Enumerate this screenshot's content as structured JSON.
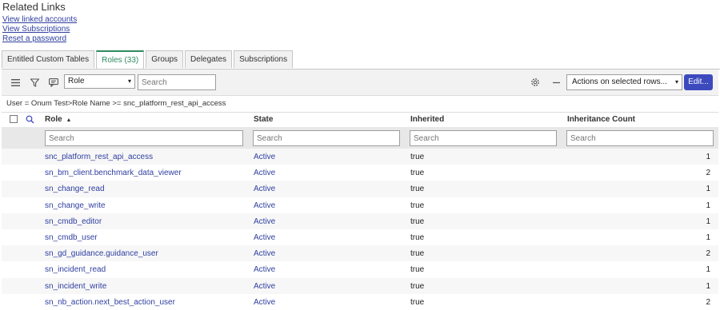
{
  "related": {
    "title": "Related Links",
    "links": [
      "View linked accounts",
      "View Subscriptions",
      "Reset a password"
    ]
  },
  "tabs": [
    {
      "label": "Entitled Custom Tables",
      "active": false
    },
    {
      "label": "Roles (33)",
      "active": true
    },
    {
      "label": "Groups",
      "active": false
    },
    {
      "label": "Delegates",
      "active": false
    },
    {
      "label": "Subscriptions",
      "active": false
    }
  ],
  "toolbar": {
    "filter_field": "Role",
    "search_placeholder": "Search",
    "actions_label": "Actions on selected rows...",
    "edit_label": "Edit..."
  },
  "breadcrumb": "User = Onum Test>Role Name >= snc_platform_rest_api_access",
  "columns": {
    "role": "Role",
    "sort_indicator": "▲",
    "state": "State",
    "inherited": "Inherited",
    "count": "Inheritance Count"
  },
  "column_search_placeholder": "Search",
  "rows": [
    {
      "role": "snc_platform_rest_api_access",
      "state": "Active",
      "inherited": "true",
      "count": "1"
    },
    {
      "role": "sn_bm_client.benchmark_data_viewer",
      "state": "Active",
      "inherited": "true",
      "count": "2"
    },
    {
      "role": "sn_change_read",
      "state": "Active",
      "inherited": "true",
      "count": "1"
    },
    {
      "role": "sn_change_write",
      "state": "Active",
      "inherited": "true",
      "count": "1"
    },
    {
      "role": "sn_cmdb_editor",
      "state": "Active",
      "inherited": "true",
      "count": "1"
    },
    {
      "role": "sn_cmdb_user",
      "state": "Active",
      "inherited": "true",
      "count": "1"
    },
    {
      "role": "sn_gd_guidance.guidance_user",
      "state": "Active",
      "inherited": "true",
      "count": "2"
    },
    {
      "role": "sn_incident_read",
      "state": "Active",
      "inherited": "true",
      "count": "1"
    },
    {
      "role": "sn_incident_write",
      "state": "Active",
      "inherited": "true",
      "count": "1"
    },
    {
      "role": "sn_nb_action.next_best_action_user",
      "state": "Active",
      "inherited": "true",
      "count": "2"
    }
  ]
}
